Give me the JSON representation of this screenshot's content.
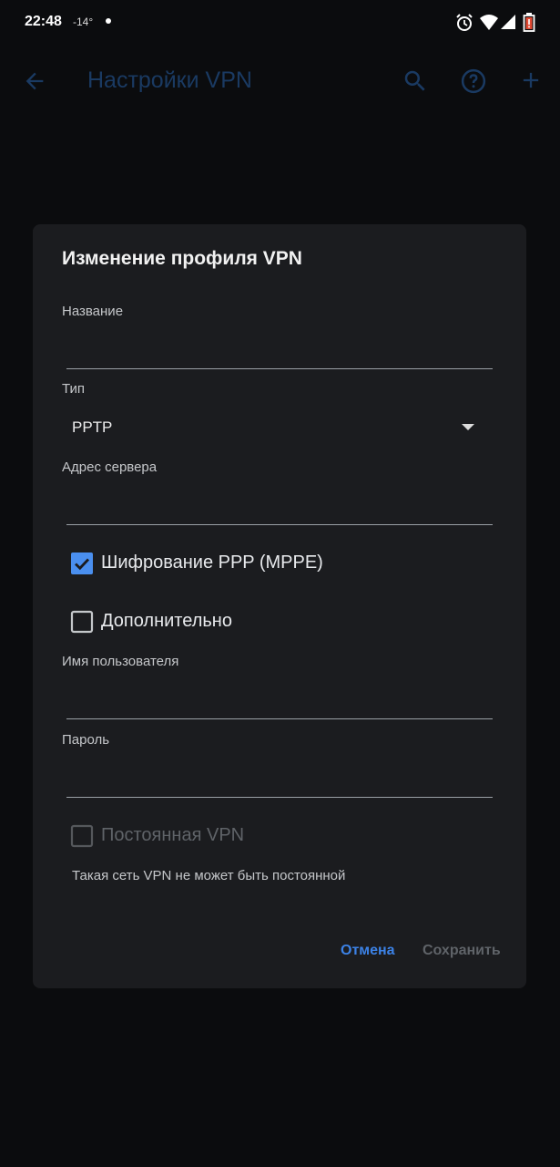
{
  "status_bar": {
    "time": "22:48",
    "temperature": "-14°",
    "icons": [
      "notification-dot-icon",
      "alarm-icon",
      "wifi-icon",
      "cell-signal-icon",
      "battery-low-icon"
    ]
  },
  "app_bar": {
    "title": "Настройки VPN",
    "icons": [
      "back-arrow-icon",
      "search-icon",
      "help-icon",
      "add-icon"
    ]
  },
  "dialog": {
    "title": "Изменение профиля VPN",
    "name_field": {
      "label": "Название",
      "value": ""
    },
    "type_field": {
      "label": "Тип",
      "value": "PPTP"
    },
    "server_field": {
      "label": "Адрес сервера",
      "value": ""
    },
    "mppe_checkbox": {
      "label": "Шифрование PPP (MPPE)",
      "checked": true
    },
    "advanced_checkbox": {
      "label": "Дополнительно",
      "checked": false
    },
    "username_field": {
      "label": "Имя пользователя",
      "value": ""
    },
    "password_field": {
      "label": "Пароль",
      "value": ""
    },
    "always_on_checkbox": {
      "label": "Постоянная VPN",
      "checked": false,
      "enabled": false
    },
    "always_on_note": "Такая сеть VPN не может быть постоянной",
    "buttons": {
      "cancel": "Отмена",
      "save": "Сохранить"
    }
  },
  "colors": {
    "background": "#0b0c0e",
    "dialog_background": "#1b1c1f",
    "accent": "#3c82e6",
    "dimmed_accent": "#1a3a62",
    "disabled": "#5f6368"
  }
}
